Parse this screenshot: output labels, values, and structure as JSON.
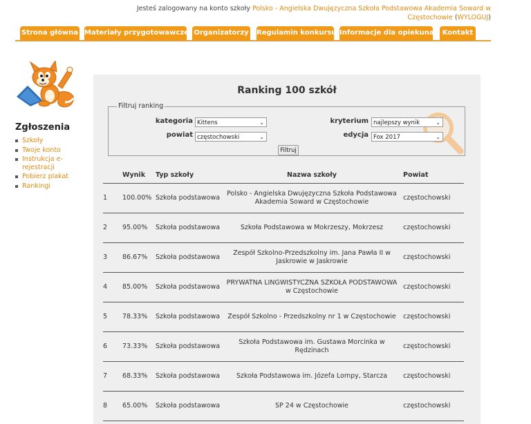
{
  "login": {
    "prefix": "Jesteś zalogowany na konto szkoły",
    "school": "Polsko - Angielska Dwujęzyczna Szkoła Podstawowa Akademia Soward w Częstochowie",
    "open": "(",
    "logout": "WYLOGUJ",
    "close": ")"
  },
  "nav": {
    "tabs": [
      {
        "label": "Strona główna"
      },
      {
        "label": "Materiały przygotowawcze"
      },
      {
        "label": "Organizatorzy"
      },
      {
        "label": "Regulamin konkursu"
      },
      {
        "label": "Informacje dla opiekuna"
      },
      {
        "label": "Kontakt"
      }
    ]
  },
  "colors": {
    "accent": "#f19a17",
    "link": "#e08a12",
    "panel": "#efefef"
  },
  "sidebar": {
    "title": "Zgłoszenia",
    "items": [
      {
        "label": "Szkoły"
      },
      {
        "label": "Twoje konto"
      },
      {
        "label": "Instrukcja e-rejestracji"
      },
      {
        "label": "Pobierz plakat"
      },
      {
        "label": "Rankingi"
      }
    ]
  },
  "main": {
    "title": "Ranking 100 szkół",
    "filter": {
      "legend": "Filtruj ranking",
      "kategoria_label": "kategoria",
      "kategoria_value": "Kittens",
      "powiat_label": "powiat",
      "powiat_value": "częstochowski",
      "kryterium_label": "kryterium",
      "kryterium_value": "najlepszy wynik",
      "edycja_label": "edycja",
      "edycja_value": "Fox 2017",
      "button": "Filtruj"
    },
    "table": {
      "headers": {
        "num": "",
        "wynik": "Wynik",
        "typ": "Typ szkoły",
        "nazwa": "Nazwa szkoły",
        "powiat": "Powiat"
      },
      "rows": [
        {
          "num": "1",
          "wynik": "100.00%",
          "typ": "Szkoła podstawowa",
          "nazwa": "Polsko - Angielska Dwujęzyczna Szkoła Podstawowa Akademia Soward w Częstochowie",
          "powiat": "częstochowski"
        },
        {
          "num": "2",
          "wynik": "95.00%",
          "typ": "Szkoła podstawowa",
          "nazwa": "Szkoła Podstawowa w Mokrzeszy, Mokrzesz",
          "powiat": "częstochowski"
        },
        {
          "num": "3",
          "wynik": "86.67%",
          "typ": "Szkoła podstawowa",
          "nazwa": "Zespół Szkolno-Przedszkolny im. Jana Pawła II w Jaskrowie w Jaskrowie",
          "powiat": "częstochowski"
        },
        {
          "num": "4",
          "wynik": "85.00%",
          "typ": "Szkoła podstawowa",
          "nazwa": "PRYWATNA LINGWISTYCZNA SZKOŁA PODSTAWOWA w Częstochowie",
          "powiat": "częstochowski"
        },
        {
          "num": "5",
          "wynik": "78.33%",
          "typ": "Szkoła podstawowa",
          "nazwa": "Zespół Szkolno - Przedszkolny nr 1 w Częstochowie",
          "powiat": "częstochowski"
        },
        {
          "num": "6",
          "wynik": "73.33%",
          "typ": "Szkoła podstawowa",
          "nazwa": "Szkoła Podstawowa im. Gustawa Morcinka w Rędzinach",
          "powiat": "częstochowski"
        },
        {
          "num": "7",
          "wynik": "68.33%",
          "typ": "Szkoła podstawowa",
          "nazwa": "Szkoła Podstawowa im. Józefa Lompy, Starcza",
          "powiat": "częstochowski"
        },
        {
          "num": "8",
          "wynik": "65.00%",
          "typ": "Szkoła podstawowa",
          "nazwa": "SP 24 w Częstochowie",
          "powiat": "częstochowski"
        }
      ]
    }
  }
}
